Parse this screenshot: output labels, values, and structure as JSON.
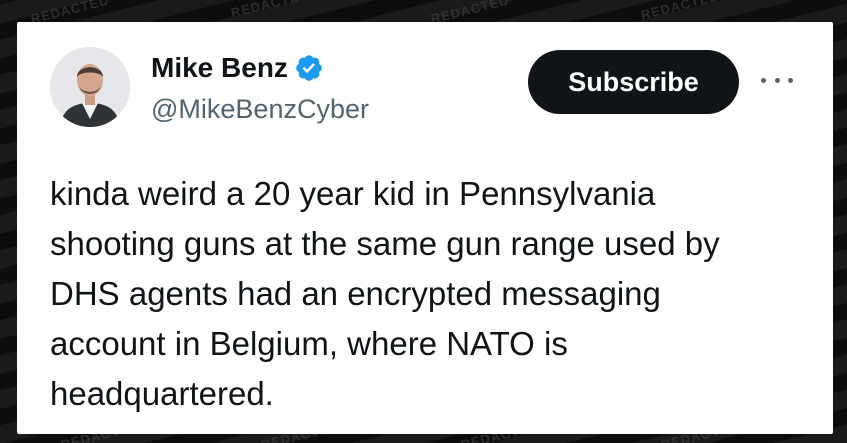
{
  "author": {
    "name": "Mike Benz",
    "handle": "@MikeBenzCyber",
    "verified_icon": "verified-badge-icon",
    "verified_color": "#1d9bf0"
  },
  "actions": {
    "subscribe_label": "Subscribe",
    "more_icon": "more-options-icon"
  },
  "tweet": {
    "lines": [
      "kinda weird a 20 year kid in Pennsylvania",
      "shooting guns at the same gun range used by",
      "DHS agents had an encrypted messaging",
      "account in Belgium, where NATO is",
      "headquartered."
    ]
  },
  "watermark": {
    "text": "REDACTED"
  }
}
